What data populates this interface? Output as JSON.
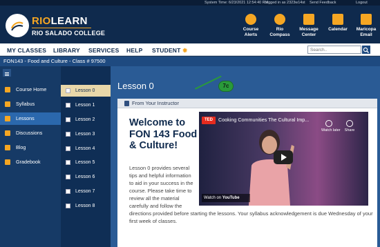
{
  "topbar": {
    "system_time": "System Time: 6/23/2021 12:54:40 PM",
    "logged_in": "Logged in as 2323w14st",
    "send_feedback": "Send Feedback",
    "logout": "Logout"
  },
  "brand": {
    "name_prefix": "RIO",
    "name_suffix": "LEARN",
    "college": "RIO SALADO COLLEGE"
  },
  "header_nav": [
    {
      "label": "Course Alerts",
      "icon": "megaphone-icon"
    },
    {
      "label": "Rio Compass",
      "icon": "compass-icon"
    },
    {
      "label": "Message Center",
      "icon": "message-icon"
    },
    {
      "label": "Calendar",
      "icon": "calendar-icon"
    },
    {
      "label": "Maricopa Email",
      "icon": "email-icon"
    }
  ],
  "menu": {
    "items": [
      "MY CLASSES",
      "LIBRARY",
      "SERVICES",
      "HELP",
      "STUDENT"
    ],
    "search_placeholder": "Search.."
  },
  "breadcrumb": "FON143 - Food and Culture - Class # 97500",
  "sidebar": {
    "items": [
      {
        "label": "Course Home",
        "icon": "home-icon",
        "active": false
      },
      {
        "label": "Syllabus",
        "icon": "syllabus-icon",
        "active": false
      },
      {
        "label": "Lessons",
        "icon": "lessons-icon",
        "active": true
      },
      {
        "label": "Discussions",
        "icon": "discussions-icon",
        "active": false
      },
      {
        "label": "Blog",
        "icon": "blog-icon",
        "active": false
      },
      {
        "label": "Gradebook",
        "icon": "gradebook-icon",
        "active": false
      }
    ]
  },
  "lessons_list": [
    "Lesson 0",
    "Lesson 1",
    "Lesson 2",
    "Lesson 3",
    "Lesson 4",
    "Lesson 5",
    "Lesson 6",
    "Lesson 7",
    "Lesson 8"
  ],
  "main": {
    "title": "Lesson 0",
    "card_header": "From Your Instructor",
    "welcome": "Welcome to FON 143 Food & Culture!",
    "body": "Lesson 0 provides several tips and helpful information to aid in your success in the course. Please take time to review all the material carefully and follow the directions provided before starting the lessons. Your syllabus acknowledgement is due Wednesday of your first week of classes."
  },
  "video": {
    "badge": "TED",
    "title": "Cooking Communities The Cultural Imp...",
    "watch_later": "Watch later",
    "share": "Share",
    "watch_on": "Watch on",
    "youtube": "YouTube"
  },
  "callout": "7c",
  "colors": {
    "navy": "#0f2a4d",
    "accent_orange": "#f5a623",
    "callout_green": "#2a9a3a"
  }
}
